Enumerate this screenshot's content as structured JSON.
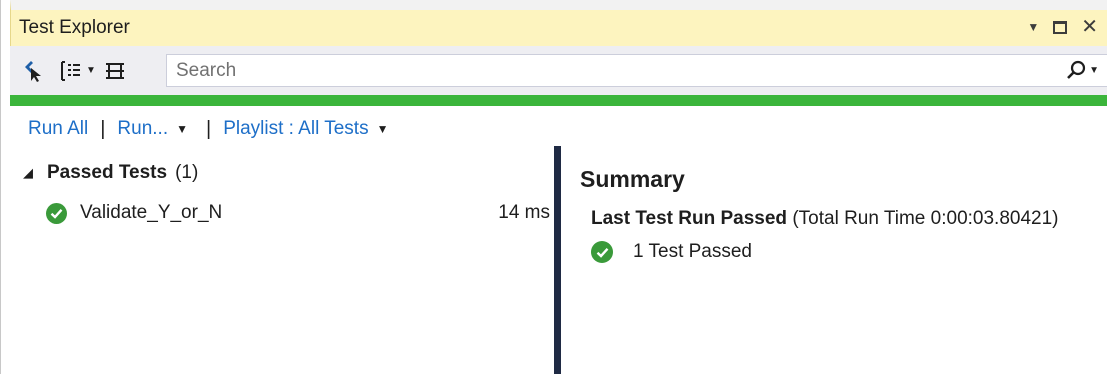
{
  "window": {
    "title": "Test Explorer"
  },
  "toolbar": {
    "search_placeholder": "Search"
  },
  "progress": {
    "fraction": 1.0,
    "color": "#3bb53b"
  },
  "commands": {
    "run_all": "Run All",
    "run": "Run...",
    "playlist": "Playlist : All Tests",
    "separator": "|"
  },
  "tree": {
    "group": {
      "label": "Passed Tests",
      "count": "(1)"
    },
    "tests": [
      {
        "name": "Validate_Y_or_N",
        "duration": "14 ms"
      }
    ]
  },
  "summary": {
    "heading": "Summary",
    "last_run_title": "Last Test Run Passed",
    "last_run_detail": "(Total Run Time 0:00:03.80421)",
    "passed_text": "1 Test Passed"
  },
  "colors": {
    "title_bg": "#fdf4bf",
    "link": "#1e6fc8",
    "pass_green": "#3a9a3a",
    "splitter": "#1f2a44"
  }
}
